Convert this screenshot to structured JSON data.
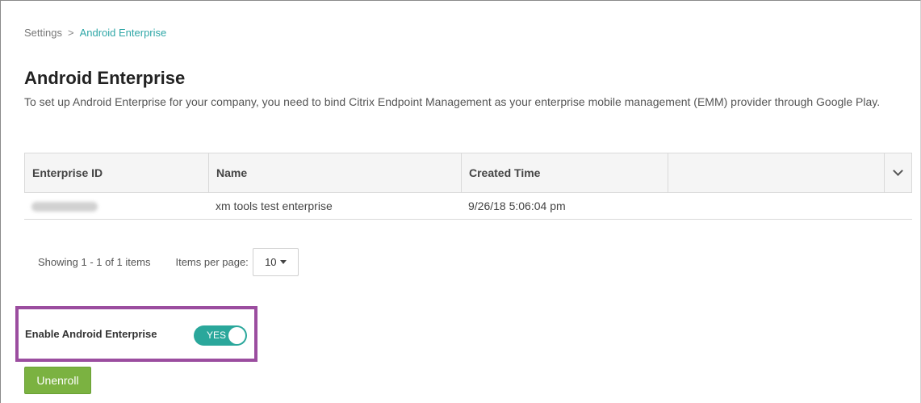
{
  "breadcrumb": {
    "root": "Settings",
    "separator": ">",
    "current": "Android Enterprise"
  },
  "page": {
    "title": "Android Enterprise",
    "description": "To set up Android Enterprise for your company, you need to bind Citrix Endpoint Management as your enterprise mobile management (EMM) provider through Google Play."
  },
  "table": {
    "columns": [
      "Enterprise ID",
      "Name",
      "Created Time",
      ""
    ],
    "rows": [
      {
        "enterprise_id": "",
        "name": "xm tools test enterprise",
        "created_time": "9/26/18 5:06:04 pm"
      }
    ],
    "column_menu_icon": "chevron-down-icon"
  },
  "pager": {
    "showing": "Showing 1 - 1 of 1 items",
    "items_per_page_label": "Items per page:",
    "items_per_page_value": "10"
  },
  "enable": {
    "label": "Enable Android Enterprise",
    "toggle_text": "YES",
    "on": true
  },
  "actions": {
    "unenroll_label": "Unenroll"
  },
  "colors": {
    "link": "#2fa7a7",
    "toggle_on": "#2aa79b",
    "unenroll_button": "#7bb241",
    "highlight": "#9b4d9f"
  }
}
